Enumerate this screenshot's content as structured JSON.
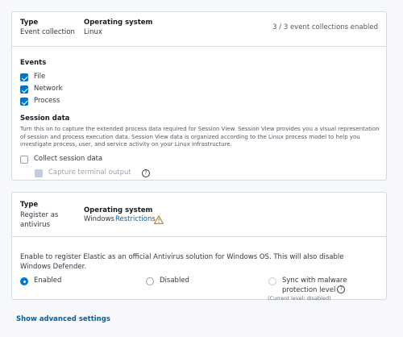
{
  "linux_section": {
    "type_label": "Type",
    "type_value": "Event collection",
    "os_label": "Operating system",
    "os_value": "Linux",
    "summary": "3 / 3 event collections enabled",
    "events_heading": "Events",
    "events": [
      {
        "label": "File",
        "checked": true
      },
      {
        "label": "Network",
        "checked": true
      },
      {
        "label": "Process",
        "checked": true
      }
    ],
    "session_data": {
      "heading": "Session data",
      "description": "Turn this on to capture the extended process data required for Session View. Session View provides you a visual representation of session and process execution data. Session View data is organized according to the Linux process model to help you investigate process, user, and service activity on your Linux infrastructure.",
      "collect_label": "Collect session data",
      "collect_checked": false,
      "terminal_label": "Capture terminal output",
      "terminal_disabled": true
    }
  },
  "antivirus_section": {
    "type_label": "Type",
    "type_value": "Register as antivirus",
    "os_label": "Operating system",
    "os_value": "Windows",
    "restrictions_link": "Restrictions",
    "description": "Enable to register Elastic as an official Antivirus solution for Windows OS. This will also disable Windows Defender.",
    "options": [
      {
        "label": "Enabled",
        "selected": true
      },
      {
        "label": "Disabled",
        "selected": false
      },
      {
        "label": "Sync with malware protection level",
        "selected": false,
        "note": "(Current level: disabled)"
      }
    ]
  },
  "advanced_link": "Show advanced settings",
  "colors": {
    "accent": "#0077cc",
    "warning": "#b7841f",
    "border": "#d3dae6"
  }
}
